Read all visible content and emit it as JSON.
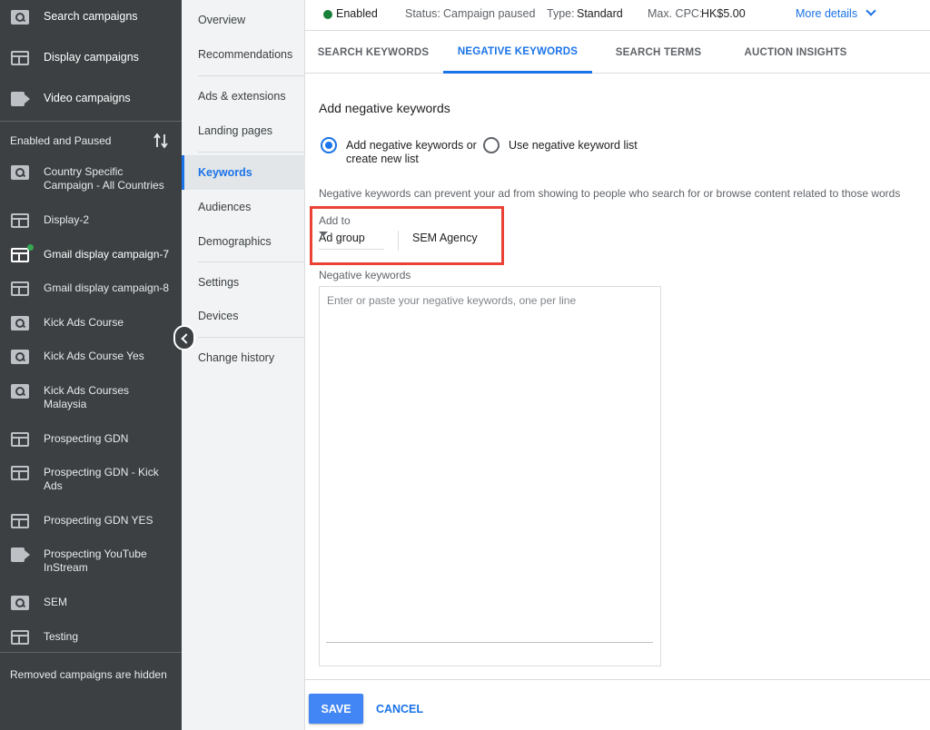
{
  "colors": {
    "sidebar_bg": "#3c4043",
    "nav_bg": "#f1f3f4",
    "accent": "#1a73e8",
    "status_enabled": "#188038",
    "highlight_box": "#ea4335",
    "save_button": "#4285f4"
  },
  "sidebar": {
    "top_items": [
      {
        "label": "Search campaigns",
        "icon": "search-campaign-icon"
      },
      {
        "label": "Display campaigns",
        "icon": "display-campaign-icon"
      },
      {
        "label": "Video campaigns",
        "icon": "video-campaign-icon"
      }
    ],
    "filter_label": "Enabled and Paused",
    "sort_icon": "sort-arrows-icon",
    "campaigns": [
      {
        "label": "Country Specific Campaign - All Countries",
        "icon": "search-campaign-icon"
      },
      {
        "label": "Display-2",
        "icon": "display-campaign-icon"
      },
      {
        "label": "Gmail display campaign-7",
        "icon": "display-campaign-icon",
        "active": true
      },
      {
        "label": "Gmail display campaign-8",
        "icon": "display-campaign-icon"
      },
      {
        "label": "Kick Ads Course",
        "icon": "search-campaign-icon"
      },
      {
        "label": "Kick Ads Course Yes",
        "icon": "search-campaign-icon"
      },
      {
        "label": "Kick Ads Courses Malaysia",
        "icon": "search-campaign-icon"
      },
      {
        "label": "Prospecting GDN",
        "icon": "display-campaign-icon"
      },
      {
        "label": "Prospecting GDN - Kick Ads",
        "icon": "display-campaign-icon"
      },
      {
        "label": "Prospecting GDN YES",
        "icon": "display-campaign-icon"
      },
      {
        "label": "Prospecting YouTube InStream",
        "icon": "video-campaign-icon"
      },
      {
        "label": "SEM",
        "icon": "search-campaign-icon"
      },
      {
        "label": "Testing",
        "icon": "display-campaign-icon"
      }
    ],
    "removed_note": "Removed campaigns are hidden"
  },
  "page_nav": {
    "items": [
      {
        "label": "Overview"
      },
      {
        "label": "Recommendations"
      },
      {
        "label": "Ads & extensions"
      },
      {
        "label": "Landing pages"
      },
      {
        "label": "Keywords",
        "active": true
      },
      {
        "label": "Audiences"
      },
      {
        "label": "Demographics"
      },
      {
        "label": "Settings"
      },
      {
        "label": "Devices"
      },
      {
        "label": "Change history"
      }
    ],
    "collapse_icon": "chevron-left-icon"
  },
  "status_bar": {
    "enabled": "Enabled",
    "status_label": "Status:",
    "status_value": "Campaign paused",
    "type_label": "Type:",
    "type_value": "Standard",
    "cpc_label": "Max. CPC:",
    "cpc_value": "HK$5.00",
    "more_details": "More details"
  },
  "tabs": [
    {
      "label": "SEARCH KEYWORDS"
    },
    {
      "label": "NEGATIVE KEYWORDS",
      "active": true
    },
    {
      "label": "SEARCH TERMS"
    },
    {
      "label": "AUCTION INSIGHTS"
    }
  ],
  "form": {
    "title": "Add negative keywords",
    "option_add": "Add negative keywords or create new list",
    "option_list": "Use negative keyword list",
    "selected_option": "add",
    "helper": "Negative keywords can prevent your ad from showing to people who search for or browse content related to those words",
    "add_to_label": "Add to",
    "level_selected": "Ad group",
    "ad_group_value": "SEM Agency",
    "negative_keywords_label": "Negative keywords",
    "negative_keywords_value": "",
    "negative_keywords_placeholder": "Enter or paste your negative keywords, one per line"
  },
  "footer": {
    "save": "SAVE",
    "cancel": "CANCEL"
  }
}
